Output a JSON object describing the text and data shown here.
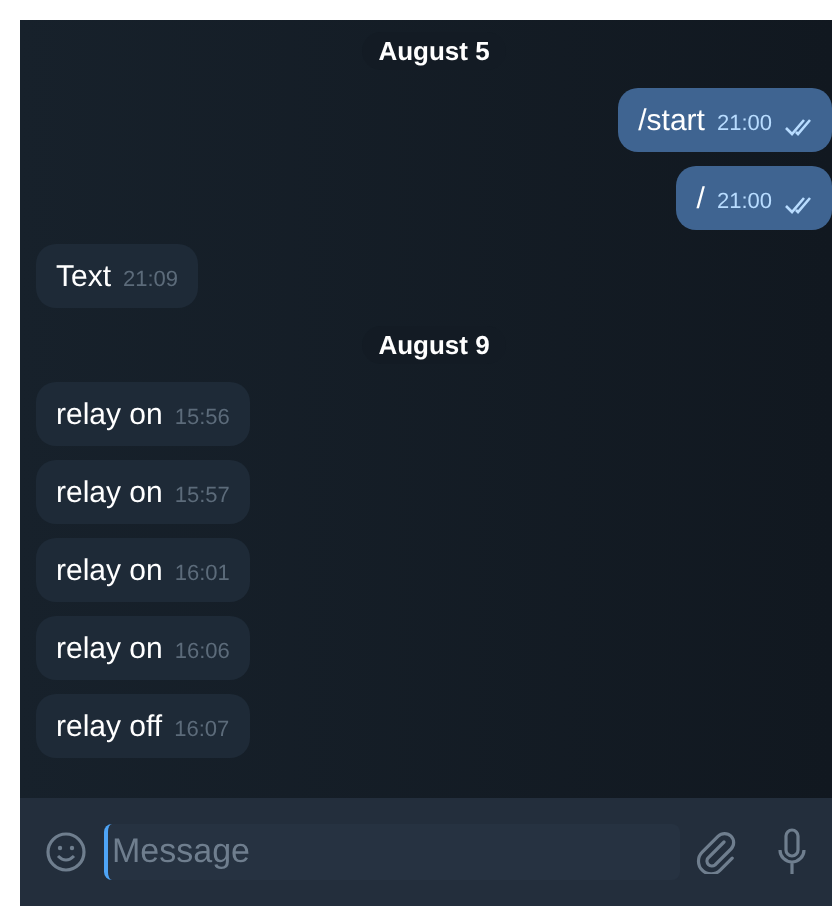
{
  "messages": [
    {
      "kind": "date",
      "text": "August 5"
    },
    {
      "kind": "out",
      "text": "/start",
      "time": "21:00",
      "read": true
    },
    {
      "kind": "out",
      "text": "/",
      "time": "21:00",
      "read": true
    },
    {
      "kind": "in",
      "text": "Text",
      "time": "21:09"
    },
    {
      "kind": "date",
      "text": "August 9"
    },
    {
      "kind": "in",
      "text": "relay on",
      "time": "15:56"
    },
    {
      "kind": "in",
      "text": "relay on",
      "time": "15:57"
    },
    {
      "kind": "in",
      "text": "relay on",
      "time": "16:01"
    },
    {
      "kind": "in",
      "text": "relay on",
      "time": "16:06"
    },
    {
      "kind": "in",
      "text": "relay off",
      "time": "16:07"
    }
  ],
  "composer": {
    "placeholder": "Message"
  }
}
